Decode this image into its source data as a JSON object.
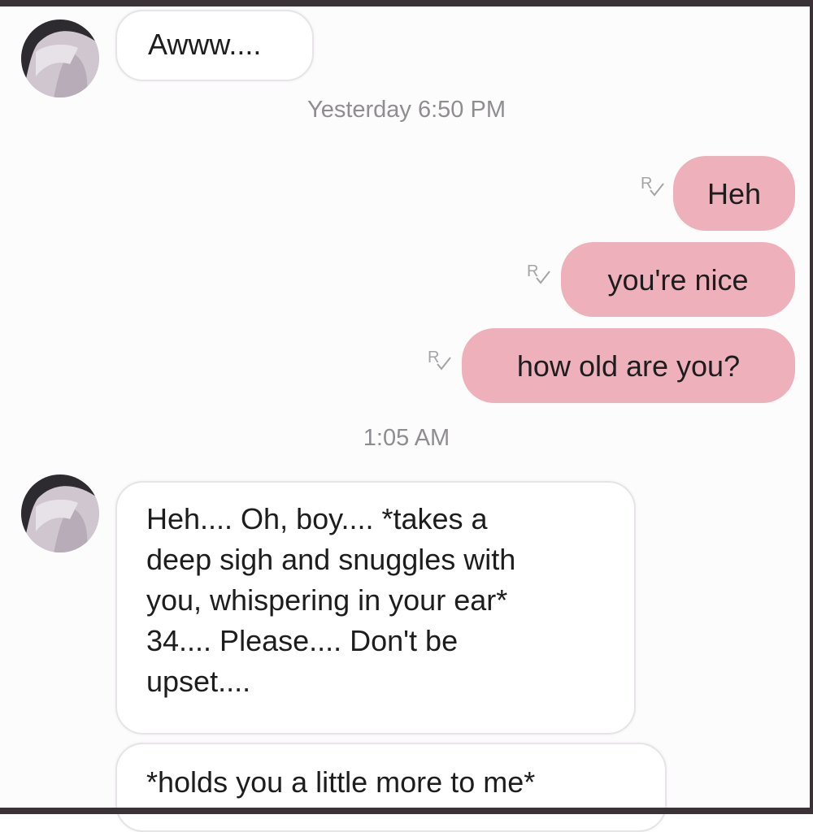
{
  "conversation": {
    "messages": {
      "m1": {
        "text": "Awww...."
      },
      "m2": {
        "text": "Heh"
      },
      "m3": {
        "text": "you're nice"
      },
      "m4": {
        "text": "how old are you?"
      },
      "m5": {
        "lines": [
          "Heh.... Oh, boy.... *takes a",
          "deep sigh and snuggles with",
          "you, whispering in your ear*",
          "34.... Please.... Don't be",
          "upset...."
        ]
      },
      "m6": {
        "text": "*holds you a little more to me*"
      }
    },
    "timestamps": {
      "t1": "Yesterday 6:50 PM",
      "t2": "1:05 AM"
    },
    "read_receipt_glyph": "R"
  },
  "icons": {
    "avatar": "avatar-icon",
    "receipt": "read-receipt-icon"
  },
  "colors": {
    "outgoing_bubble": "#eeb0bb",
    "incoming_bubble": "#ffffff",
    "timestamp_text": "#8f8d90",
    "frame": "#3a3236"
  }
}
